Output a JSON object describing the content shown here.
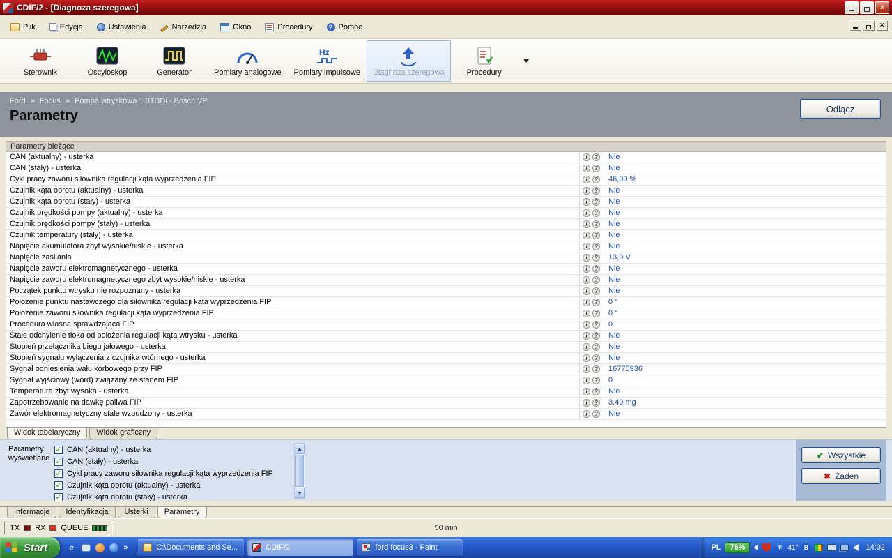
{
  "window": {
    "title": "CDIF/2 - [Diagnoza szeregowa]"
  },
  "menu_bar": {
    "items": [
      {
        "label": "Plik",
        "icon": "file-icon"
      },
      {
        "label": "Edycja",
        "icon": "edit-icon"
      },
      {
        "label": "Ustawienia",
        "icon": "settings-icon"
      },
      {
        "label": "Narzędzia",
        "icon": "tools-icon"
      },
      {
        "label": "Okno",
        "icon": "window-icon"
      },
      {
        "label": "Procedury",
        "icon": "procedures-icon"
      },
      {
        "label": "Pomoc",
        "icon": "help-icon"
      }
    ]
  },
  "toolbar": {
    "buttons": [
      {
        "label": "Sterownik",
        "icon": "controller-icon",
        "active": false
      },
      {
        "label": "Oscyloskop",
        "icon": "oscilloscope-icon",
        "active": false
      },
      {
        "label": "Generator",
        "icon": "generator-icon",
        "active": false
      },
      {
        "label": "Pomiary analogowe",
        "icon": "analog-gauge-icon",
        "active": false
      },
      {
        "label": "Pomiary impulsowe",
        "icon": "impulse-hz-icon",
        "active": false
      },
      {
        "label": "Diagnoza szeregowa",
        "icon": "serial-diagnosis-icon",
        "active": true
      },
      {
        "label": "Procedury",
        "icon": "procedures-doc-icon",
        "active": false
      }
    ]
  },
  "header": {
    "breadcrumb": [
      "Ford",
      "Focus",
      "Pompa wtryskowa 1.8TDDi - Bosch VP"
    ],
    "separator": "»",
    "title": "Parametry",
    "disconnect_button": "Odłącz"
  },
  "parameters": {
    "section_title": "Parametry bieżące",
    "rows": [
      {
        "name": "CAN (aktualny) - usterka",
        "value": "Nie"
      },
      {
        "name": "CAN (stały) - usterka",
        "value": "Nie"
      },
      {
        "name": "Cykl pracy zaworu siłownika regulacji kąta wyprzedzenia FIP",
        "value": "46,99 %"
      },
      {
        "name": "Czujnik kąta obrotu (aktualny) - usterka",
        "value": "Nie"
      },
      {
        "name": "Czujnik kąta obrotu (stały) - usterka",
        "value": "Nie"
      },
      {
        "name": "Czujnik prędkości pompy (aktualny) - usterka",
        "value": "Nie"
      },
      {
        "name": "Czujnik prędkości pompy (stały) - usterka",
        "value": "Nie"
      },
      {
        "name": "Czujnik temperatury (stały) - usterka",
        "value": "Nie"
      },
      {
        "name": "Napięcie akumulatora zbyt wysokie/niskie - usterka",
        "value": "Nie"
      },
      {
        "name": "Napięcie zasilania",
        "value": "13,9 V"
      },
      {
        "name": "Napięcie zaworu elektromagnetycznego - usterka",
        "value": "Nie"
      },
      {
        "name": "Napięcie zaworu elektromagnetycznego zbyt wysokie/niskie - usterka",
        "value": "Nie"
      },
      {
        "name": "Początek punktu wtrysku nie rozpoznany - usterka",
        "value": "Nie"
      },
      {
        "name": "Położenie punktu nastawczego dla siłownika regulacji kąta wyprzedzenia FIP",
        "value": "0 °"
      },
      {
        "name": "Położenie zaworu siłownika regulacji kąta wyprzedzenia FIP",
        "value": "0 °"
      },
      {
        "name": "Procedura własna sprawdzająca FIP",
        "value": "0"
      },
      {
        "name": "Stałe odchylenie tłoka od położenia regulacji kąta wtrysku - usterka",
        "value": "Nie"
      },
      {
        "name": "Stopień przełącznika biegu jałowego - usterka",
        "value": "Nie"
      },
      {
        "name": "Stopień sygnału wyłączenia z czujnika wtórnego - usterka",
        "value": "Nie"
      },
      {
        "name": "Sygnał odniesienia wału korbowego przy FIP",
        "value": "16775936"
      },
      {
        "name": "Sygnał wyjściowy (word) związany ze stanem FIP",
        "value": "0"
      },
      {
        "name": "Temperatura zbyt wysoka - usterka",
        "value": "Nie"
      },
      {
        "name": "Zapotrzebowanie na dawkę paliwa FIP",
        "value": "3,49 mg"
      },
      {
        "name": "Zawór elektromagnetyczny stale wzbudzony - usterka",
        "value": "Nie"
      }
    ]
  },
  "view_tabs": {
    "tabs": [
      {
        "label": "Widok tabelaryczny",
        "active": true
      },
      {
        "label": "Widok graficzny",
        "active": false
      }
    ]
  },
  "display_panel": {
    "label": "Parametry wyświetlane",
    "items": [
      {
        "label": "CAN (aktualny) - usterka",
        "checked": true
      },
      {
        "label": "CAN (stały) - usterka",
        "checked": true
      },
      {
        "label": "Cykl pracy zaworu siłownika regulacji kąta wyprzedzenia FIP",
        "checked": true
      },
      {
        "label": "Czujnik kąta obrotu (aktualny) - usterka",
        "checked": true
      },
      {
        "label": "Czujnik kąta obrotu (stały) - usterka",
        "checked": true
      }
    ],
    "all_button": "Wszystkie",
    "none_button": "Żaden"
  },
  "bottom_tabs": {
    "tabs": [
      {
        "label": "Informacje",
        "active": false
      },
      {
        "label": "Identyfikacja",
        "active": false
      },
      {
        "label": "Usterki",
        "active": false
      },
      {
        "label": "Parametry",
        "active": true
      }
    ]
  },
  "status_bar": {
    "tx_label": "TX",
    "rx_label": "RX",
    "queue_label": "QUEUE",
    "center_text": "50 min"
  },
  "taskbar": {
    "start_label": "Start",
    "quick_launch_more": "»",
    "tasks": [
      {
        "label": "C:\\Documents and Se...",
        "icon": "folder-icon",
        "active": false
      },
      {
        "label": "CDIF/2",
        "icon": "cdif-icon",
        "active": true
      },
      {
        "label": "ford focus3 - Paint",
        "icon": "paint-icon",
        "active": false
      }
    ],
    "tray": {
      "lang": "PL",
      "battery": "76%",
      "temp": "41°",
      "bluetooth": "B",
      "clock": "14:02"
    }
  }
}
